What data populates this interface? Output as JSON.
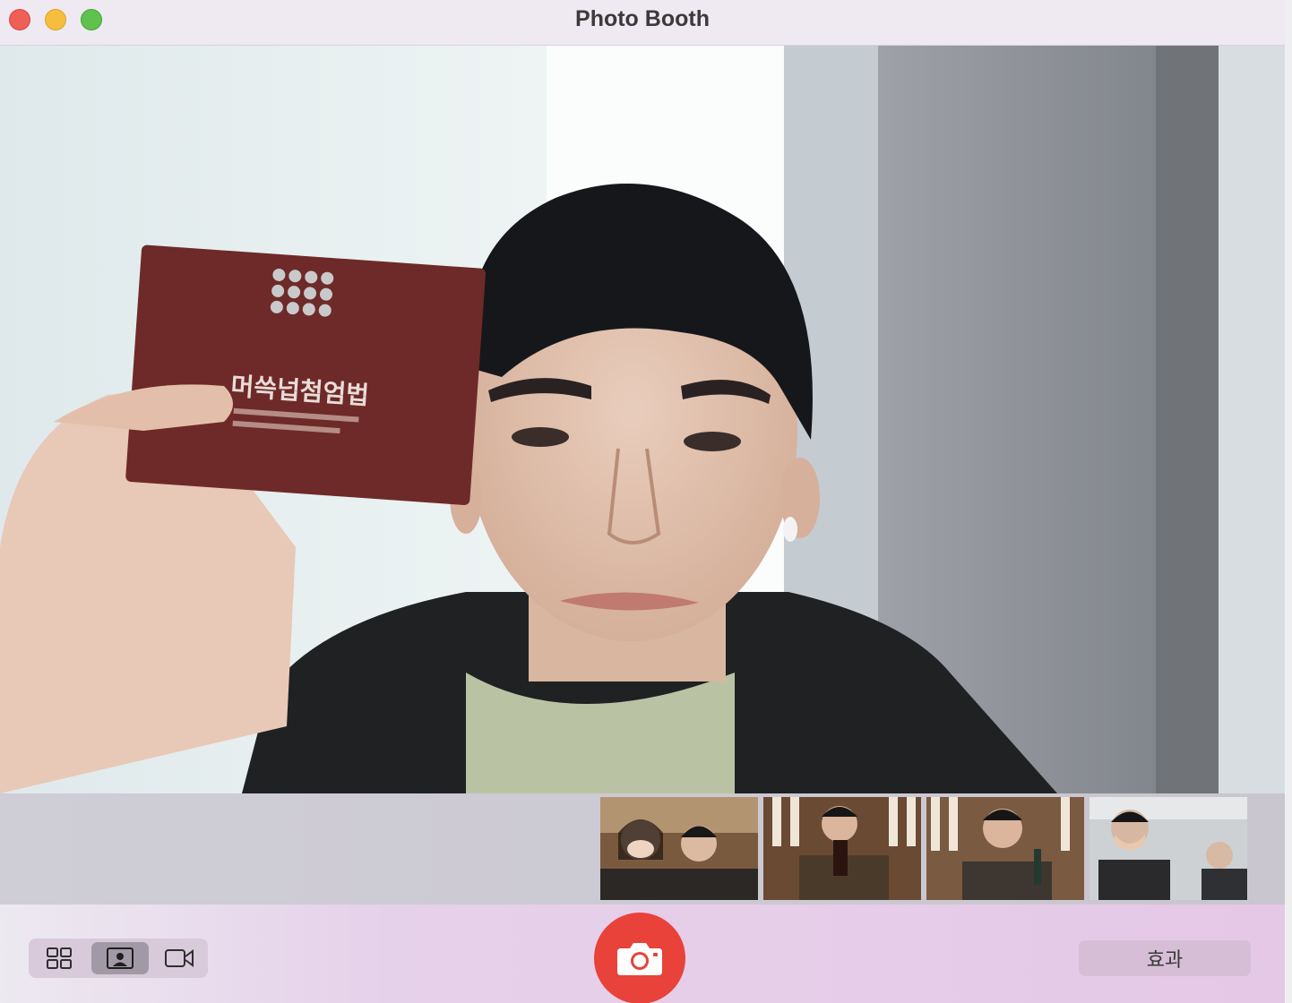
{
  "window": {
    "title": "Photo Booth"
  },
  "traffic_lights": {
    "close": "close-button",
    "minimize": "minimize-button",
    "zoom": "zoom-button"
  },
  "preview": {
    "package_text": "머쓱넙첨엄법"
  },
  "thumbnails": [
    {
      "name": "photo-1"
    },
    {
      "name": "photo-2"
    },
    {
      "name": "photo-3"
    },
    {
      "name": "photo-4"
    }
  ],
  "controls": {
    "view_modes": [
      {
        "icon": "grid-icon",
        "active": false
      },
      {
        "icon": "single-photo-icon",
        "active": true
      },
      {
        "icon": "video-camera-icon",
        "active": false
      }
    ],
    "shutter_icon": "camera-icon",
    "effects_label": "효과"
  },
  "colors": {
    "shutter": "#e8423a",
    "close": "#ee5f57",
    "minimize": "#f6be3d",
    "zoom": "#5ec24d"
  }
}
